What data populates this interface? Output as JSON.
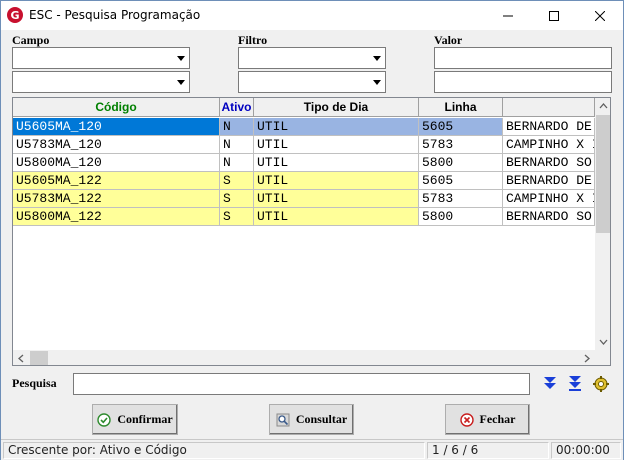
{
  "window": {
    "title": "ESC - Pesquisa Programação",
    "icon_letter": "G"
  },
  "filters": {
    "campo_label": "Campo",
    "filtro_label": "Filtro",
    "valor_label": "Valor",
    "campo1": "",
    "campo2": "",
    "filtro1": "",
    "filtro2": "",
    "valor1": "",
    "valor2": ""
  },
  "grid": {
    "columns": [
      {
        "label": "Código",
        "color": "#008000"
      },
      {
        "label": "Ativo",
        "color": "#0000c0"
      },
      {
        "label": "Tipo de Dia",
        "color": "#000000"
      },
      {
        "label": "Linha",
        "color": "#000000"
      },
      {
        "label": "",
        "color": "#000000"
      }
    ],
    "rows": [
      {
        "codigo": "U5605MA_120",
        "ativo": "N",
        "tipo": "UTIL",
        "linha": "5605",
        "desc": "BERNARDO DE",
        "style": "selected"
      },
      {
        "codigo": "U5783MA_120",
        "ativo": "N",
        "tipo": "UTIL",
        "linha": "5783",
        "desc": "CAMPINHO X I",
        "style": "normal"
      },
      {
        "codigo": "U5800MA_120",
        "ativo": "N",
        "tipo": "UTIL",
        "linha": "5800",
        "desc": "BERNARDO SO",
        "style": "normal"
      },
      {
        "codigo": "U5605MA_122",
        "ativo": "S",
        "tipo": "UTIL",
        "linha": "5605",
        "desc": "BERNARDO DE",
        "style": "highlight"
      },
      {
        "codigo": "U5783MA_122",
        "ativo": "S",
        "tipo": "UTIL",
        "linha": "5783",
        "desc": "CAMPINHO X I",
        "style": "highlight"
      },
      {
        "codigo": "U5800MA_122",
        "ativo": "S",
        "tipo": "UTIL",
        "linha": "5800",
        "desc": "BERNARDO SO",
        "style": "highlight"
      }
    ],
    "colors": {
      "selected": "#99b4e2",
      "highlight": "#ffff99",
      "normal": "#ffffff"
    }
  },
  "search": {
    "label": "Pesquisa",
    "value": ""
  },
  "buttons": {
    "confirmar": "Confirmar",
    "consultar": "Consultar",
    "fechar": "Fechar"
  },
  "status": {
    "sort": "Crescente por: Ativo e Código",
    "record": "1 / 6 / 6",
    "time": "00:00:00"
  }
}
